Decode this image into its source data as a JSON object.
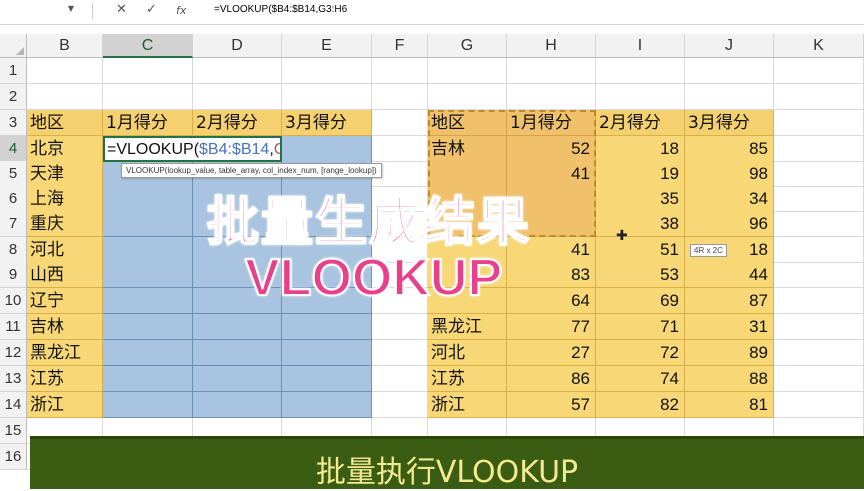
{
  "formula_bar": {
    "name_box": "",
    "cancel_icon": "✕",
    "enter_icon": "✓",
    "fx_icon": "fx",
    "formula": "=VLOOKUP($B4:$B14,G3:H6"
  },
  "columns": [
    "B",
    "C",
    "D",
    "E",
    "F",
    "G",
    "H",
    "I",
    "J",
    "K"
  ],
  "rows": [
    "1",
    "2",
    "3",
    "4",
    "5",
    "6",
    "7",
    "8",
    "9",
    "10",
    "11",
    "12",
    "13",
    "14",
    "15",
    "16"
  ],
  "left_table": {
    "headers": [
      "地区",
      "1月得分",
      "2月得分",
      "3月得分"
    ],
    "regions": [
      "北京",
      "天津",
      "上海",
      "重庆",
      "河北",
      "山西",
      "辽宁",
      "吉林",
      "黑龙江",
      "江苏",
      "浙江"
    ]
  },
  "active_cell": {
    "prefix": "=VLOOKUP(",
    "arg1": "$B4:$B14",
    "comma": ",",
    "arg2": "G3:H6",
    "arg1_color": "#4472c4",
    "arg2_color": "#c0504d"
  },
  "tooltip": "VLOOKUP(lookup_value, table_array, col_index_num, [range_lookup])",
  "right_table": {
    "headers": [
      "地区",
      "1月得分",
      "2月得分",
      "3月得分"
    ],
    "rows": [
      [
        "吉林",
        "52",
        "18",
        "85"
      ],
      [
        "",
        "41",
        "19",
        "98"
      ],
      [
        "",
        "",
        "35",
        "34"
      ],
      [
        "",
        "",
        "38",
        "96"
      ],
      [
        "",
        "41",
        "51",
        "18"
      ],
      [
        "",
        "83",
        "53",
        "44"
      ],
      [
        "",
        "64",
        "69",
        "87"
      ],
      [
        "黑龙江",
        "77",
        "71",
        "31"
      ],
      [
        "河北",
        "27",
        "72",
        "89"
      ],
      [
        "江苏",
        "86",
        "74",
        "88"
      ],
      [
        "浙江",
        "57",
        "82",
        "81"
      ]
    ]
  },
  "overlay": {
    "line1": "批量生成结果",
    "line2": "VLOOKUP",
    "color": "#e8408a"
  },
  "size_hint": "4R x 2C",
  "banner": {
    "text": "批量执行VLOOKUP",
    "bg": "#3a5c13",
    "fg": "#f3e98e"
  }
}
